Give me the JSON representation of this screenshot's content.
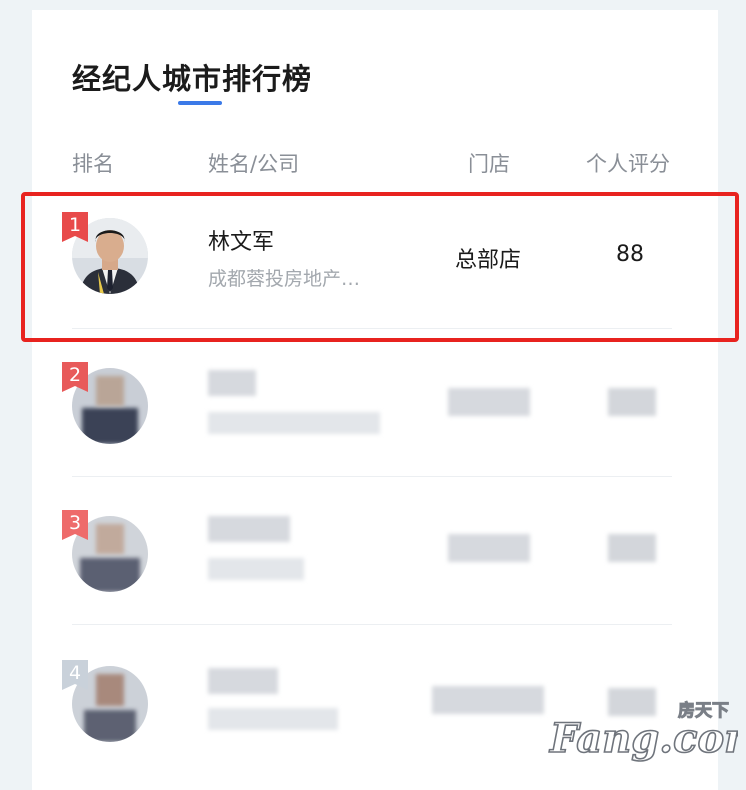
{
  "page": {
    "title": "经纪人城市排行榜"
  },
  "columns": {
    "rank": "排名",
    "name_company": "姓名/公司",
    "store": "门店",
    "score": "个人评分"
  },
  "rows": [
    {
      "rank": "1",
      "name": "林文军",
      "company": "成都蓉投房地产…",
      "store": "总部店",
      "score": "88",
      "badge_color": "#e84a4a",
      "highlighted": true,
      "blurred": false
    },
    {
      "rank": "2",
      "badge_color": "#e85a5a",
      "blurred": true
    },
    {
      "rank": "3",
      "badge_color": "#ee6b6b",
      "blurred": true
    },
    {
      "rank": "4",
      "badge_color": "#c9d1da",
      "blurred": true
    }
  ],
  "watermark": {
    "top": "房天下",
    "main": "Fang.com"
  },
  "colors": {
    "accent_blue": "#3b7ae8",
    "highlight_red": "#e8231f"
  }
}
